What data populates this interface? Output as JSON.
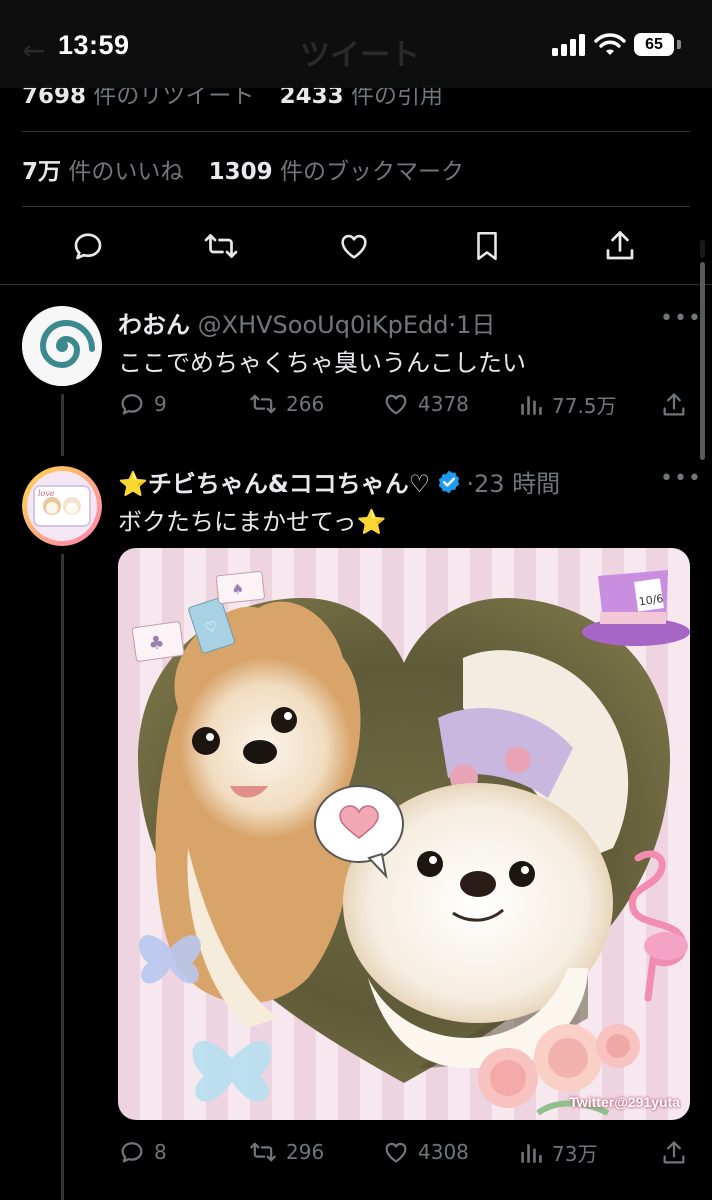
{
  "status": {
    "time": "13:59",
    "battery": "65",
    "ghost_title": "ツイート"
  },
  "stats": {
    "retweets_count": "7698",
    "retweets_label": "件のリツイート",
    "quotes_count": "2433",
    "quotes_label": "件の引用",
    "likes_count": "7万",
    "likes_label": "件のいいね",
    "bookmarks_count": "1309",
    "bookmarks_label": "件のブックマーク"
  },
  "replies": [
    {
      "display_name": "わおん",
      "handle": "@XHVSooUq0iKpEdd",
      "time": "·1日",
      "text": "ここでめちゃくちゃ臭いうんこしたい",
      "reply_count": "9",
      "retweet_count": "266",
      "like_count": "4378",
      "view_count": "77.5万"
    },
    {
      "display_name": "⭐チビちゃん&ココちゃん♡",
      "handle": "",
      "time": "·23 時間",
      "text": "ボクたちにまかせてっ⭐",
      "reply_count": "8",
      "retweet_count": "296",
      "like_count": "4308",
      "view_count": "73万",
      "media_watermark": "Twitter@291yuta",
      "media_hat_tag": "10/6"
    }
  ],
  "colors": {
    "background": "#000000",
    "muted": "#71767b",
    "text": "#e7e9ea",
    "verified": "#1d9bf0"
  },
  "icons": [
    "reply-icon",
    "retweet-icon",
    "like-icon",
    "bookmark-icon",
    "share-icon",
    "views-icon",
    "verified-badge-icon",
    "more-icon"
  ]
}
